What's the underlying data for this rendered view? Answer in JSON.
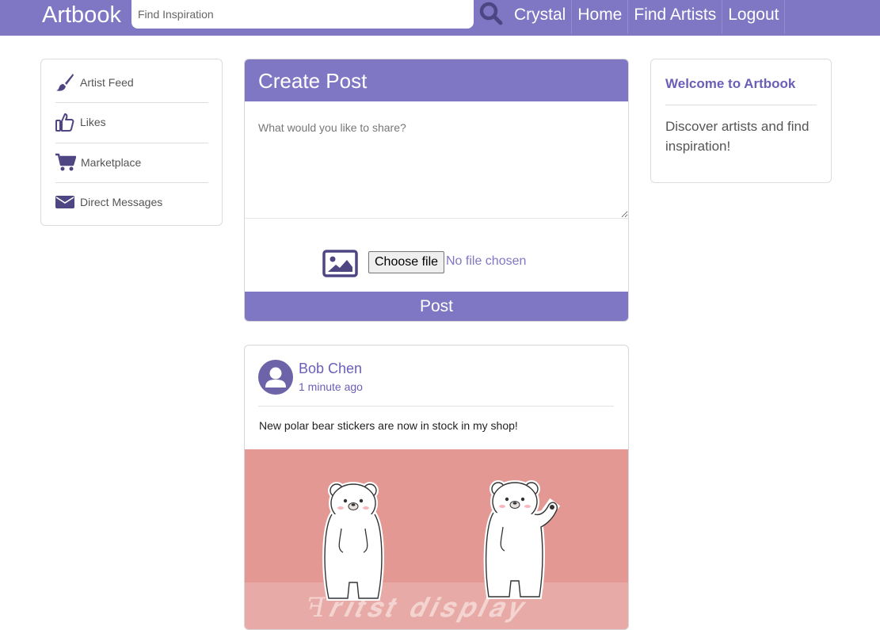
{
  "navbar": {
    "brand": "Artbook",
    "search_placeholder": "Find Inspiration",
    "search_icon": "magnifier-icon",
    "links": [
      "Crystal",
      "Home",
      "Find Artists",
      "Logout"
    ]
  },
  "sidebar": {
    "items": [
      {
        "label": "Artist Feed",
        "icon": "paintbrush-icon"
      },
      {
        "label": "Likes",
        "icon": "thumbs-up-icon"
      },
      {
        "label": "Marketplace",
        "icon": "shopping-cart-icon"
      },
      {
        "label": "Direct Messages",
        "icon": "envelope-icon"
      }
    ]
  },
  "create_post": {
    "title": "Create Post",
    "placeholder": "What would you like to share?",
    "image_icon": "image-icon",
    "file_button": "Choose file",
    "file_status": "No file chosen",
    "submit": "Post"
  },
  "post": {
    "author": "Bob Chen",
    "time": "1 minute ago",
    "text": "New polar bear stickers are now in stock in my shop!",
    "image_alt_icons": [
      "polar-bear-sticker",
      "waving-polar-bear-sticker"
    ]
  },
  "welcome": {
    "title": "Welcome to Artbook",
    "text": "Discover artists and find inspiration!"
  },
  "colors": {
    "accent": "#7f76c4",
    "link": "#6a5fb8",
    "icon": "#4e4683",
    "image_bg": "#e39894"
  }
}
